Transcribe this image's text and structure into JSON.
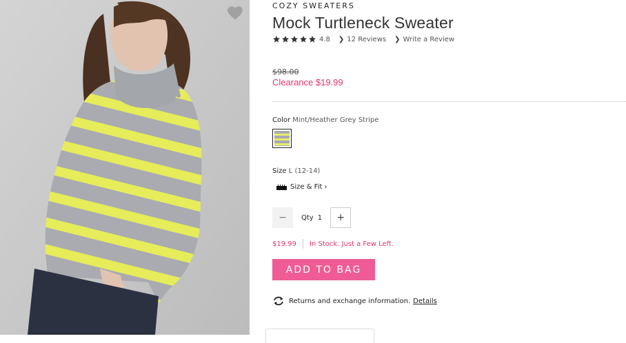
{
  "product": {
    "brand": "COZY SWEATERS",
    "title": "Mock Turtleneck Sweater",
    "rating": {
      "value": 4.8,
      "value_label": "4.8",
      "stars_filled": 5,
      "reviews_label": "12 Reviews",
      "write_review_label": "Write a Review"
    },
    "price": {
      "original": "$98.00",
      "sale": "Clearance $19.99"
    },
    "color": {
      "label": "Color",
      "value": "Mint/Heather Grey Stripe"
    },
    "size": {
      "label": "Size",
      "value": "L (12-14)",
      "size_fit_label": "Size & Fit",
      "size_fit_chevron": "›"
    },
    "quantity": {
      "minus_symbol": "−",
      "plus_symbol": "+",
      "label": "Qty",
      "value": "1"
    },
    "stock": {
      "price": "$19.99",
      "status": "In Stock. Just a Few Left."
    },
    "add_to_bag_label": "ADD TO BAG",
    "returns": {
      "text": "Returns and exchange information.",
      "link_label": "Details"
    }
  },
  "colors": {
    "accent_pink": "#e0356e",
    "button_pink": "#ef5c95",
    "swatch_grey": "#a8aab0",
    "swatch_yellow": "#e8ec6a"
  },
  "icons": {
    "favorite": "heart-icon",
    "star": "star-icon",
    "ruler": "ruler-icon",
    "returns": "exchange-arrows-icon"
  }
}
